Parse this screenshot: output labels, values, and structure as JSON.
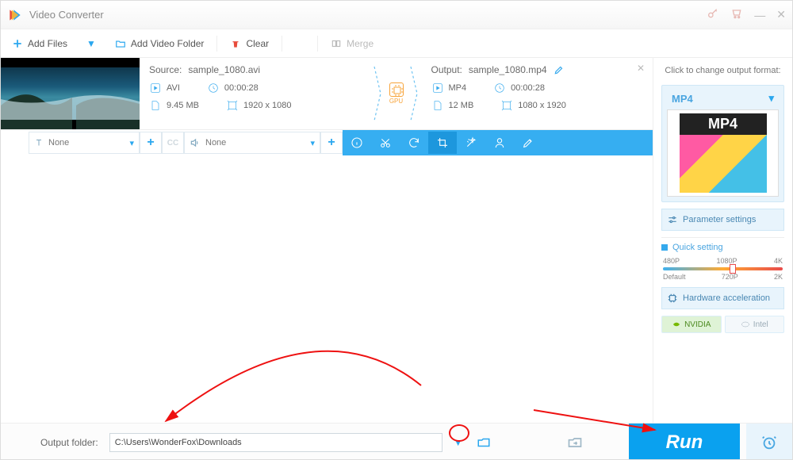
{
  "title": "Video Converter",
  "toolbar": {
    "add_files": "Add Files",
    "add_folder": "Add Video Folder",
    "clear": "Clear",
    "merge": "Merge"
  },
  "card": {
    "source_label": "Source:",
    "source_name": "sample_1080.avi",
    "src_fmt": "AVI",
    "src_dur": "00:00:28",
    "src_size": "9.45 MB",
    "src_res": "1920 x 1080",
    "gpu": "GPU",
    "output_label": "Output:",
    "output_name": "sample_1080.mp4",
    "out_fmt": "MP4",
    "out_dur": "00:00:28",
    "out_size": "12 MB",
    "out_res": "1080 x 1920",
    "subtitle_sel": "None",
    "audio_sel": "None"
  },
  "right": {
    "title": "Click to change output format:",
    "format": "MP4",
    "tile_label": "MP4",
    "param_btn": "Parameter settings",
    "quick_title": "Quick setting",
    "p": [
      "480P",
      "1080P",
      "4K"
    ],
    "p2": [
      "Default",
      "720P",
      "2K"
    ],
    "hw_btn": "Hardware acceleration",
    "nvidia": "NVIDIA",
    "intel": "Intel"
  },
  "bottom": {
    "label": "Output folder:",
    "path": "C:\\Users\\WonderFox\\Downloads",
    "run": "Run"
  }
}
